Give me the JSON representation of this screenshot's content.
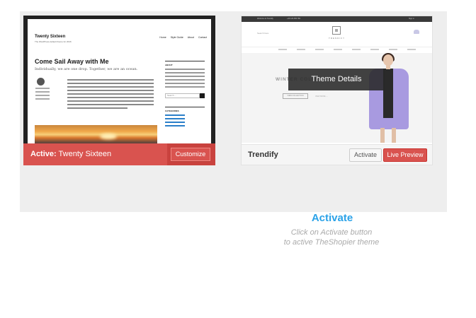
{
  "theme_active": {
    "screenshot": {
      "site_title": "Twenty Sixteen",
      "tagline": "The WordPress default theme for 2016",
      "menu": [
        "Home",
        "Style Guide",
        "About",
        "Contact"
      ],
      "post_title": "Come Sail Away with Me",
      "post_subtitle": "Individually, we are one drop. Together, we are an ocean.",
      "widget_about": "ABOUT",
      "widget_search_placeholder": "Search ...",
      "widget_categories": "CATEGORIES"
    },
    "status_prefix": "Active:",
    "name": "Twenty Sixteen",
    "customize_label": "Customize",
    "color": "#d9534f"
  },
  "theme_trendify": {
    "screenshot": {
      "topbar_left": "Welcome to Trendify",
      "topbar_mid": "+44 123 456 789",
      "topbar_right": "Sign in",
      "logo_text": "TRENDIFY",
      "search_hint": "Search here",
      "hero_text": "WINTER COLLECTION",
      "view_collection": "VIEW COLLECTION",
      "view_more": "VIEW MORE →"
    },
    "overlay_label": "Theme Details",
    "name": "Trendify",
    "activate_label": "Activate",
    "live_preview_label": "Live Preview",
    "accent": "#d9534f"
  },
  "caption": {
    "title": "Activate",
    "line1": "Click on Activate button",
    "line2": "to active TheShopier theme",
    "title_color": "#2aa2e8"
  }
}
